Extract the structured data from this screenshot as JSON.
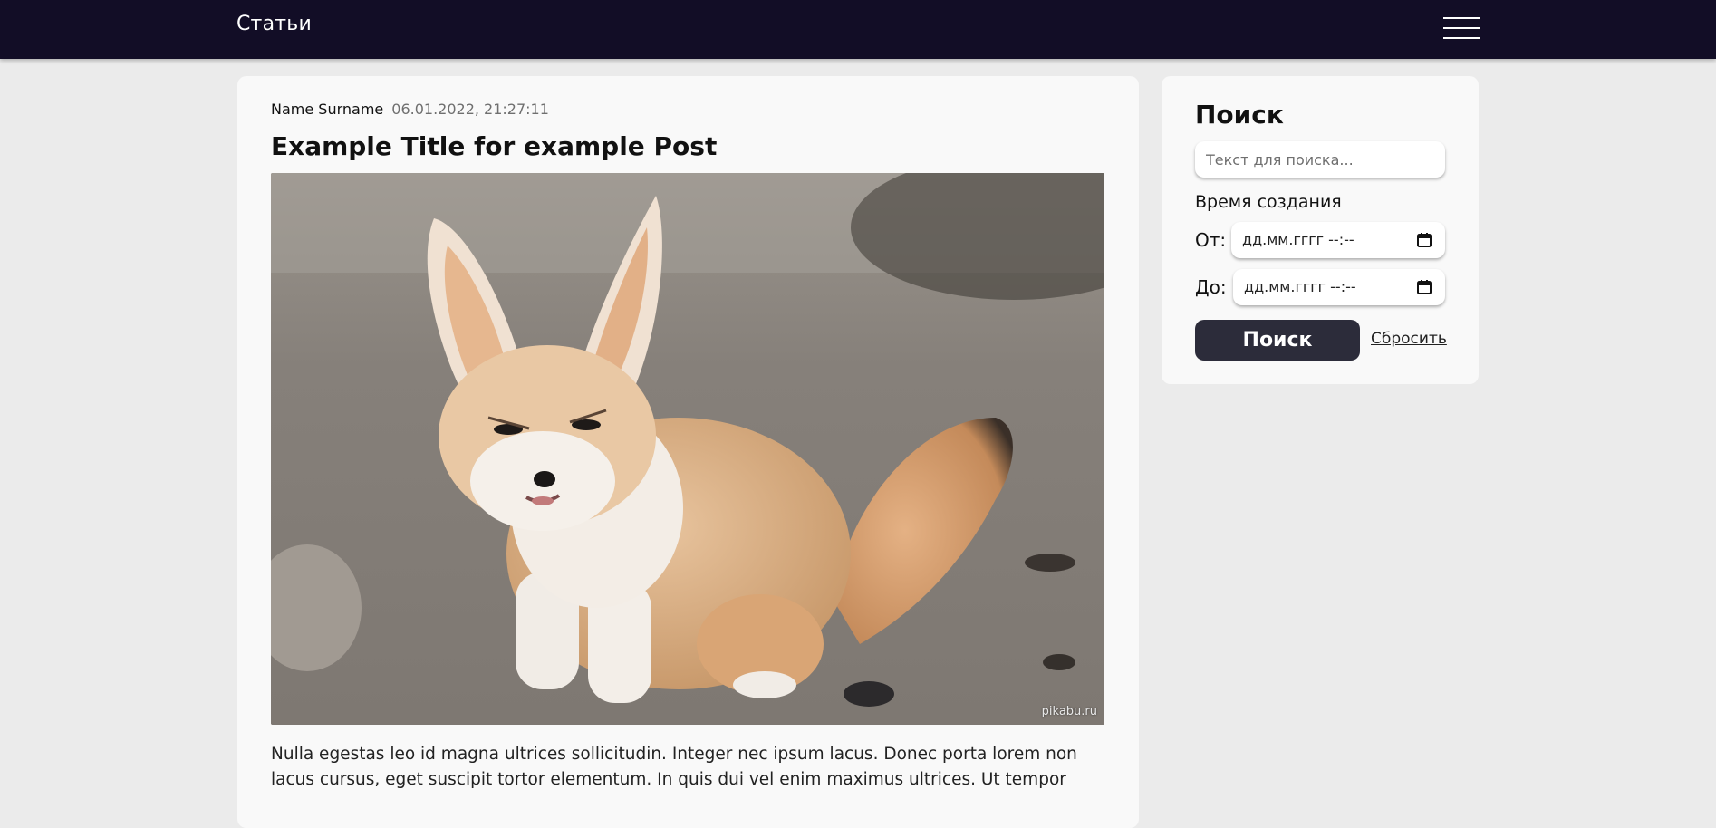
{
  "header": {
    "brand": "Статьи",
    "menu_icon": "hamburger-menu-icon"
  },
  "post": {
    "author": "Name Surname",
    "date": "06.01.2022, 21:27:11",
    "title": "Example Title for example Post",
    "image_watermark": "pikabu.ru",
    "body": "Nulla egestas leo id magna ultrices sollicitudin. Integer nec ipsum lacus. Donec porta lorem non lacus cursus, eget suscipit tortor elementum. In quis dui vel enim maximus ultrices. Ut tempor"
  },
  "search": {
    "title": "Поиск",
    "placeholder": "Текст для поиска...",
    "time_label": "Время создания",
    "from_label": "От:",
    "to_label": "До:",
    "date_placeholder": "дд.мм.гггг --:--",
    "submit_label": "Поиск",
    "reset_label": "Сбросить"
  },
  "colors": {
    "header_bg": "#120d26",
    "page_bg": "#ebebeb",
    "card_bg": "#f9f9f9",
    "button_bg": "#2c2c3a"
  }
}
